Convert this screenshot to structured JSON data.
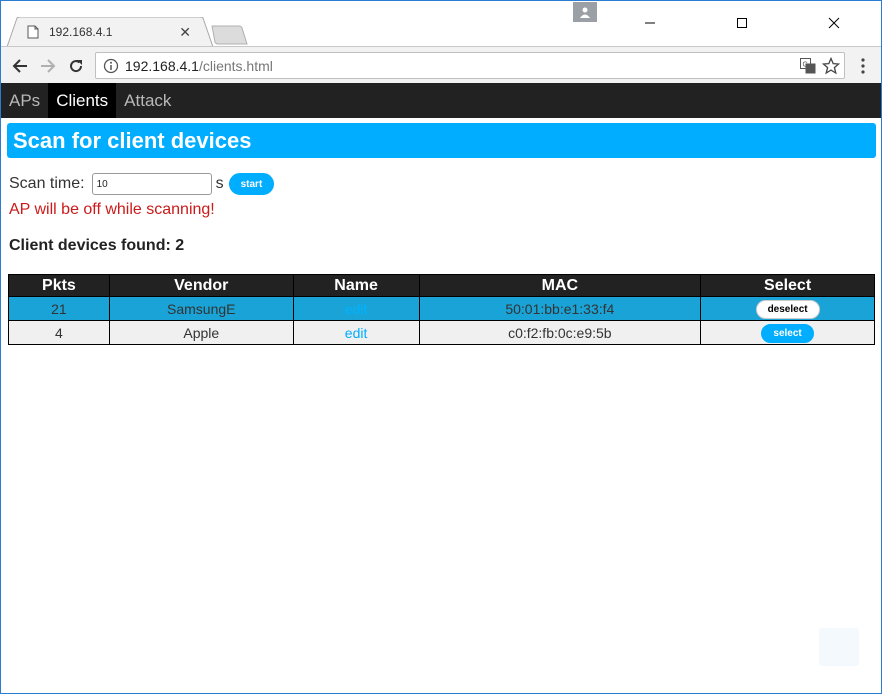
{
  "browser": {
    "tab_title": "192.168.4.1",
    "url_host": "192.168.4.1",
    "url_path": "/clients.html"
  },
  "nav": {
    "items": [
      {
        "label": "APs",
        "active": false
      },
      {
        "label": "Clients",
        "active": true
      },
      {
        "label": "Attack",
        "active": false
      }
    ]
  },
  "page": {
    "title": "Scan for client devices",
    "scan_label": "Scan time:",
    "scan_value": "10",
    "scan_unit": "s",
    "start_label": "start",
    "warning": "AP will be off while scanning!",
    "found_text": "Client devices found: 2"
  },
  "table": {
    "headers": [
      "Pkts",
      "Vendor",
      "Name",
      "MAC",
      "Select"
    ],
    "rows": [
      {
        "pkts": "21",
        "vendor": "SamsungE",
        "name": "edit",
        "mac": "50:01:bb:e1:33:f4",
        "button": "deselect",
        "selected": true
      },
      {
        "pkts": "4",
        "vendor": "Apple",
        "name": "edit",
        "mac": "c0:f2:fb:0c:e9:5b",
        "button": "select",
        "selected": false
      }
    ]
  },
  "colors": {
    "accent": "#00adff",
    "selected_row": "#1aa3d6",
    "warning": "#cc1a1a",
    "navbar": "#222222"
  }
}
